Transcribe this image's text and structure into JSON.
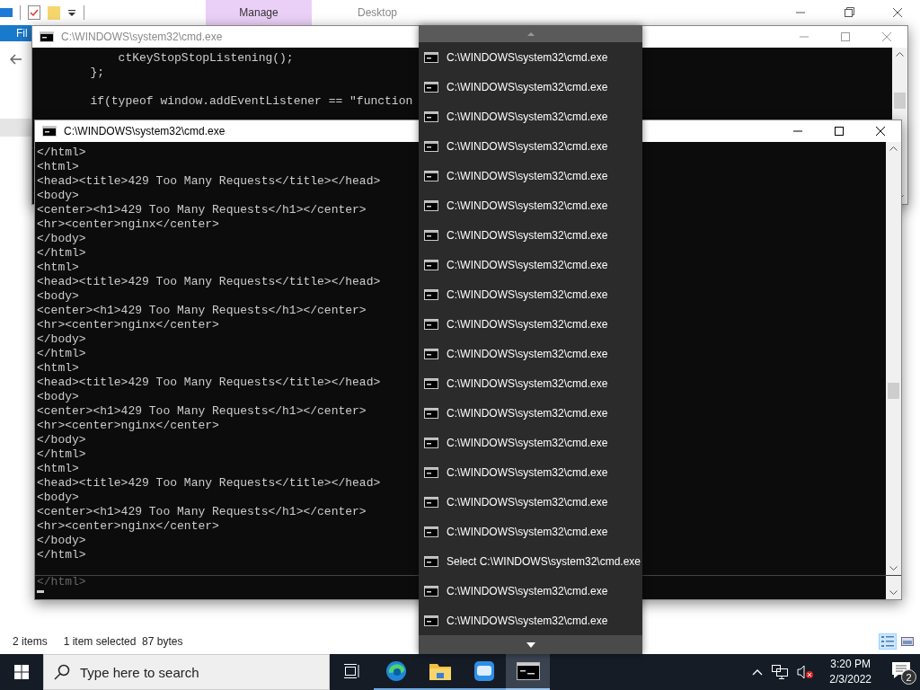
{
  "explorer": {
    "ribbon_tabs": [
      {
        "label": "Manage",
        "contextual": true
      },
      {
        "label": "Desktop",
        "contextual": false
      }
    ],
    "file_tab": "Fil",
    "status_bar": {
      "item_count": "2 items",
      "selection": "1 item selected  87 bytes"
    },
    "view_buttons": [
      {
        "kind": "details",
        "selected": true
      },
      {
        "kind": "thumbnails",
        "selected": false
      }
    ]
  },
  "windows": [
    {
      "title": "C:\\WINDOWS\\system32\\cmd.exe",
      "active": false,
      "line_blocks": [
        [
          "            ctKeyStopStopListening();",
          "        };"
        ],
        [
          "        if(typeof window.addEventListener == \"function"
        ]
      ]
    },
    {
      "title": "C:\\WINDOWS\\system32\\cmd.exe",
      "active": true,
      "line_blocks": [
        [
          "</html>",
          "<html>",
          "<head><title>429 Too Many Requests</title></head>",
          "<body>",
          "<center><h1>429 Too Many Requests</h1></center>",
          "<hr><center>nginx</center>",
          "</body>",
          "</html>",
          "<html>",
          "<head><title>429 Too Many Requests</title></head>",
          "<body>",
          "<center><h1>429 Too Many Requests</h1></center>",
          "<hr><center>nginx</center>",
          "</body>",
          "</html>",
          "<html>",
          "<head><title>429 Too Many Requests</title></head>",
          "<body>",
          "<center><h1>429 Too Many Requests</h1></center>",
          "<hr><center>nginx</center>",
          "</body>",
          "</html>",
          "<html>",
          "<head><title>429 Too Many Requests</title></head>",
          "<body>",
          "<center><h1>429 Too Many Requests</h1></center>",
          "<hr><center>nginx</center>",
          "</body>",
          "</html>"
        ]
      ],
      "split_pane_line": "</html>"
    }
  ],
  "jump_list": {
    "items": [
      {
        "label": "C:\\WINDOWS\\system32\\cmd.exe"
      },
      {
        "label": "C:\\WINDOWS\\system32\\cmd.exe"
      },
      {
        "label": "C:\\WINDOWS\\system32\\cmd.exe"
      },
      {
        "label": "C:\\WINDOWS\\system32\\cmd.exe"
      },
      {
        "label": "C:\\WINDOWS\\system32\\cmd.exe"
      },
      {
        "label": "C:\\WINDOWS\\system32\\cmd.exe"
      },
      {
        "label": "C:\\WINDOWS\\system32\\cmd.exe"
      },
      {
        "label": "C:\\WINDOWS\\system32\\cmd.exe"
      },
      {
        "label": "C:\\WINDOWS\\system32\\cmd.exe"
      },
      {
        "label": "C:\\WINDOWS\\system32\\cmd.exe"
      },
      {
        "label": "C:\\WINDOWS\\system32\\cmd.exe"
      },
      {
        "label": "C:\\WINDOWS\\system32\\cmd.exe"
      },
      {
        "label": "C:\\WINDOWS\\system32\\cmd.exe"
      },
      {
        "label": "C:\\WINDOWS\\system32\\cmd.exe"
      },
      {
        "label": "C:\\WINDOWS\\system32\\cmd.exe"
      },
      {
        "label": "C:\\WINDOWS\\system32\\cmd.exe"
      },
      {
        "label": "C:\\WINDOWS\\system32\\cmd.exe"
      },
      {
        "label": "Select C:\\WINDOWS\\system32\\cmd.exe"
      },
      {
        "label": "C:\\WINDOWS\\system32\\cmd.exe"
      },
      {
        "label": "C:\\WINDOWS\\system32\\cmd.exe"
      }
    ]
  },
  "taskbar": {
    "search": {
      "placeholder": "Type here to search"
    },
    "apps": [
      {
        "kind": "task-view",
        "running": false,
        "active": false
      },
      {
        "kind": "browser",
        "running": true,
        "active": false
      },
      {
        "kind": "folder",
        "running": true,
        "active": false
      },
      {
        "kind": "square-app",
        "running": true,
        "active": false
      },
      {
        "kind": "console",
        "running": true,
        "active": true
      }
    ],
    "clock": {
      "time": "3:20 PM",
      "date": "2/3/2022"
    },
    "notifications": "2"
  }
}
